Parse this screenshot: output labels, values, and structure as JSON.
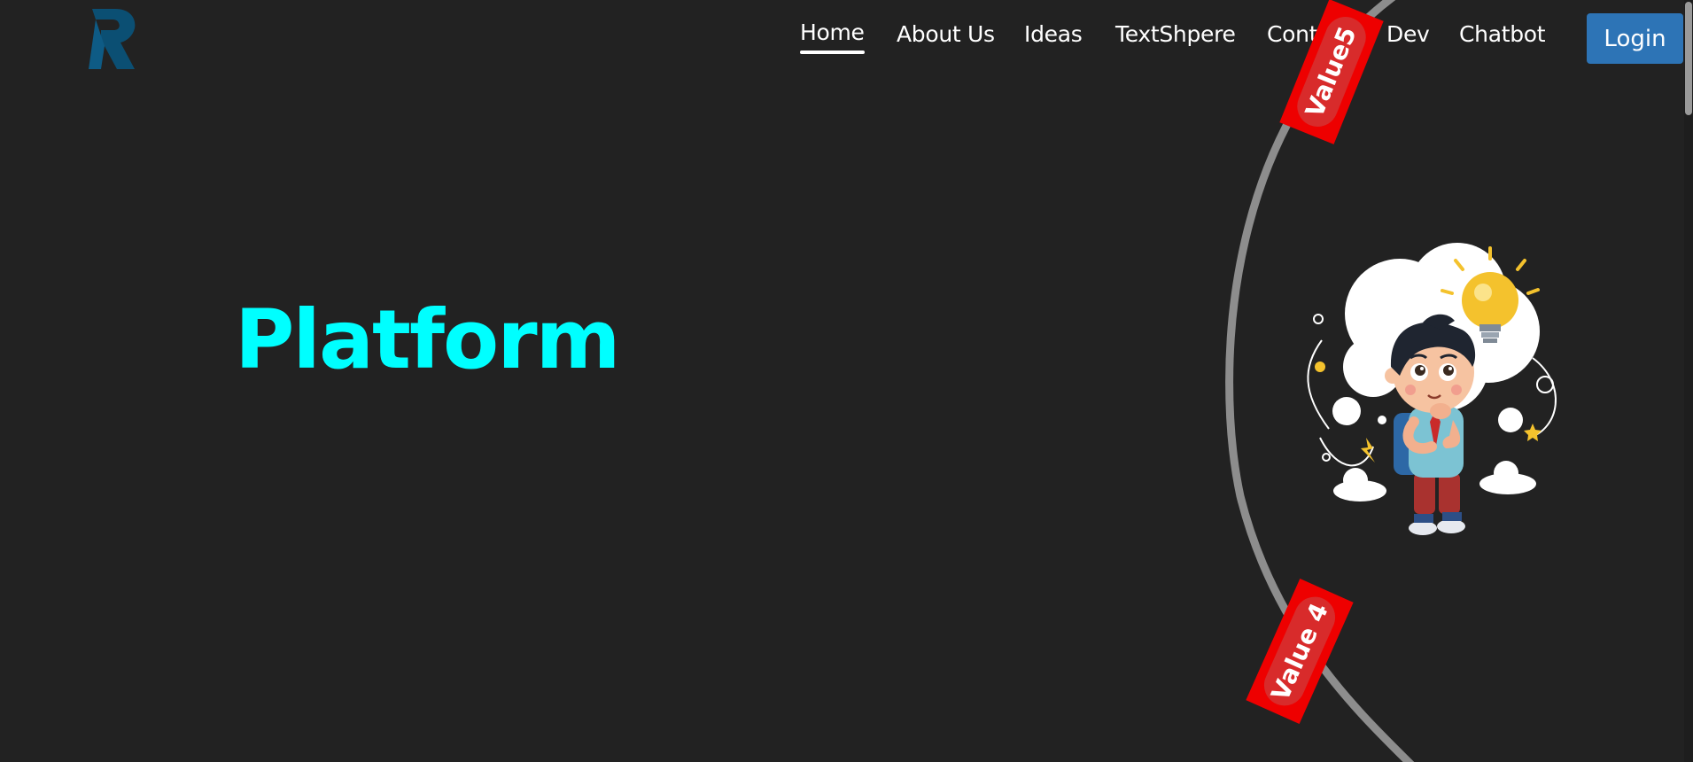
{
  "nav": {
    "items": [
      {
        "label": "Home",
        "active": true
      },
      {
        "label": "About Us",
        "active": false
      },
      {
        "label": "Ideas",
        "active": false
      },
      {
        "label": "TextShpere",
        "active": false
      },
      {
        "label": "Contact",
        "active": false
      },
      {
        "label": "Dev",
        "active": false
      },
      {
        "label": "Chatbot",
        "active": false
      }
    ],
    "login_label": "Login"
  },
  "logo": {
    "letter": "R",
    "color": "#0b4f73"
  },
  "hero": {
    "title": "Platform",
    "title_color": "#00ffff"
  },
  "decor": {
    "tags": [
      {
        "label": "Value5"
      },
      {
        "label": "Value 4"
      }
    ],
    "illustration_icon": "thinking-boy-with-lightbulb-icon",
    "arc_color": "#8d8d8d",
    "tag_color": "#ee0000"
  },
  "theme": {
    "background": "#222222",
    "accent": "#2d74b6"
  }
}
